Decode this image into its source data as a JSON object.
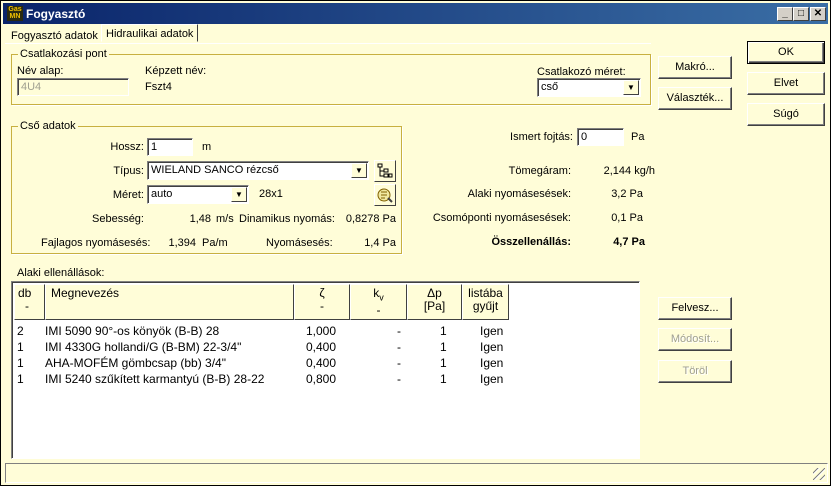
{
  "window": {
    "title": "Fogyasztó",
    "app_icon": "gas-app-icon",
    "min_glyph": "_",
    "max_glyph": "□",
    "close_glyph": "✕"
  },
  "tabs": [
    {
      "label": "Fogyasztó adatok",
      "active": false
    },
    {
      "label": "Hidraulikai adatok",
      "active": true
    }
  ],
  "dialog_buttons": {
    "ok": "OK",
    "cancel": "Elvet",
    "help": "Súgó"
  },
  "connection": {
    "group_label": "Csatlakozási pont",
    "name_base_label": "Név alap:",
    "name_base_value": "4U4",
    "derived_name_label": "Képzett név:",
    "derived_name_value": "Fszt4",
    "conn_size_label": "Csatlakozó méret:",
    "conn_size_value": "cső",
    "macro_button": "Makró...",
    "choice_button": "Választék..."
  },
  "pipe": {
    "group_label": "Cső adatok",
    "length_label": "Hossz:",
    "length_value": "1",
    "length_unit": "m",
    "type_label": "Típus:",
    "type_value": "WIELAND SANCO rézcső",
    "size_label": "Méret:",
    "size_value": "auto",
    "size_text": "28x1",
    "speed_label": "Sebesség:",
    "speed_value": "1,48",
    "speed_unit": "m/s",
    "dyn_pressure_label": "Dinamikus nyomás:",
    "dyn_pressure_value": "0,8278 Pa",
    "spec_drop_label": "Fajlagos nyomásesés:",
    "spec_drop_value": "1,394",
    "spec_drop_unit": "Pa/m",
    "drop_label": "Nyomásesés:",
    "drop_value": "1,4 Pa"
  },
  "summary": {
    "known_drop_label": "Ismert fojtás:",
    "known_drop_value": "0",
    "known_drop_unit": "Pa",
    "mass_flow_label": "Tömegáram:",
    "mass_flow_value": "2,144 kg/h",
    "shape_drop_label": "Alaki nyomásesések:",
    "shape_drop_value": "3,2 Pa",
    "node_drop_label": "Csomóponti nyomásesések:",
    "node_drop_value": "0,1 Pa",
    "total_label": "Összellenállás:",
    "total_value": "4,7 Pa"
  },
  "resistances": {
    "label": "Alaki ellenállások:",
    "columns": {
      "db": "db",
      "db_sub": "-",
      "name": "Megnevezés",
      "zeta": "ζ",
      "zeta_sub": "-",
      "kv": "k",
      "kv_subscript": "v",
      "kv_sub": "-",
      "dp": "Δp",
      "dp_sub": "[Pa]",
      "list": "listába",
      "list_sub": "gyűjt"
    },
    "rows": [
      {
        "db": "2",
        "name": "IMI 5090 90°-os könyök (B-B) 28",
        "zeta": "1,000",
        "kv": "-",
        "dp": "1",
        "list": "Igen"
      },
      {
        "db": "1",
        "name": "IMI 4330G hollandi/G (B-BM) 22-3/4\"",
        "zeta": "0,400",
        "kv": "-",
        "dp": "1",
        "list": "Igen"
      },
      {
        "db": "1",
        "name": "AHA-MOFÉM gömbcsap (bb) 3/4\"",
        "zeta": "0,400",
        "kv": "-",
        "dp": "1",
        "list": "Igen"
      },
      {
        "db": "1",
        "name": "IMI 5240 szűkített karmantyú (B-B) 28-22",
        "zeta": "0,800",
        "kv": "-",
        "dp": "1",
        "list": "Igen"
      }
    ],
    "add_button": "Felvesz...",
    "modify_button": "Módosít...",
    "delete_button": "Töröl"
  },
  "colors": {
    "background": "#fffdd8",
    "titlebar": "#0a246a",
    "disabled_text": "#a0a090"
  }
}
